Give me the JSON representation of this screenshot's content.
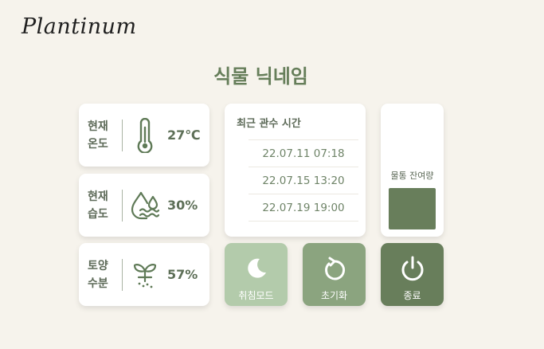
{
  "app": {
    "logo": "Plantinum"
  },
  "plant": {
    "nickname": "식물 닉네임"
  },
  "sensors": [
    {
      "label": "현재\n온도",
      "value": "27℃",
      "icon": "thermometer-icon"
    },
    {
      "label": "현재\n습도",
      "value": "30%",
      "icon": "humidity-icon"
    },
    {
      "label": "토양\n수분",
      "value": "57%",
      "icon": "sprout-icon"
    }
  ],
  "watering": {
    "title": "최근 관수 시간",
    "times": [
      "22.07.11  07:18",
      "22.07.15  13:20",
      "22.07.19  19:00"
    ]
  },
  "tank": {
    "label": "물통 잔여량",
    "level_percent": 100,
    "color": "#687e5b"
  },
  "buttons": {
    "sleep": {
      "label": "취침모드",
      "icon": "moon-icon",
      "color": "#b3cbab"
    },
    "reset": {
      "label": "초기화",
      "icon": "reset-icon",
      "color": "#8ba47f"
    },
    "quit": {
      "label": "종료",
      "icon": "power-icon",
      "color": "#687e5b"
    }
  },
  "colors": {
    "background": "#f6f3ec",
    "accent": "#667e5a"
  }
}
